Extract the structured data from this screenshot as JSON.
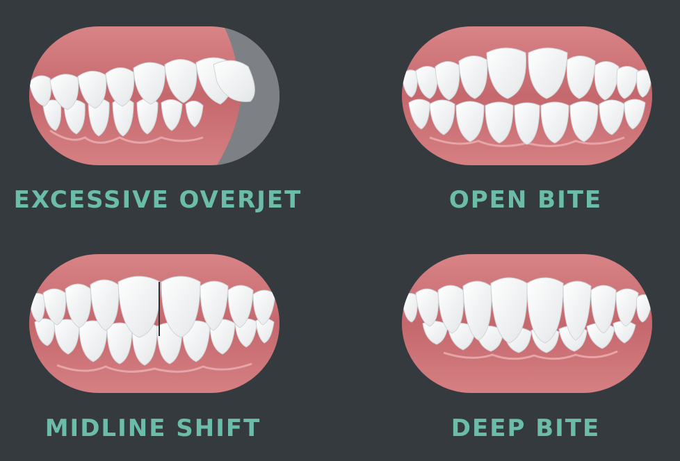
{
  "colors": {
    "background": "#353a3e",
    "label": "#6cbcaa",
    "gum": "#c87377",
    "gum_dark": "#b05e63",
    "lip_inner": "#de9ea0",
    "tooth": "#ffffff",
    "tooth_shadow": "#d9dcde",
    "overlay": "#7d8084"
  },
  "panels": [
    {
      "id": "overjet",
      "label": "EXCESSIVE OVERJET",
      "icon": "excessive-overjet-teeth-illustration"
    },
    {
      "id": "open",
      "label": "OPEN BITE",
      "icon": "open-bite-teeth-illustration"
    },
    {
      "id": "midline",
      "label": "MIDLINE SHIFT",
      "icon": "midline-shift-teeth-illustration"
    },
    {
      "id": "deep",
      "label": "DEEP BITE",
      "icon": "deep-bite-teeth-illustration"
    }
  ]
}
